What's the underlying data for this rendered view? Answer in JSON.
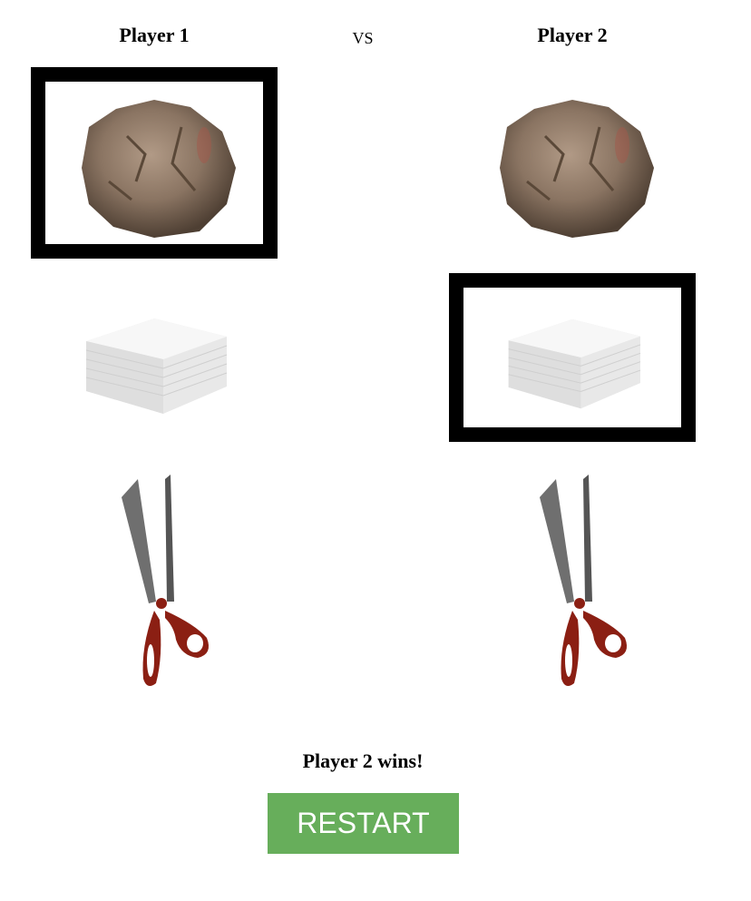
{
  "players": {
    "p1": {
      "title": "Player 1",
      "selected": "rock"
    },
    "p2": {
      "title": "Player 2",
      "selected": "paper"
    }
  },
  "vs_label": "VS",
  "choices": [
    "rock",
    "paper",
    "scissors"
  ],
  "result": "Player 2 wins!",
  "restart_label": "RESTART",
  "colors": {
    "restart_bg": "#67ae5b",
    "selection_border": "#000000",
    "scissor_handle": "#8b1f13"
  }
}
